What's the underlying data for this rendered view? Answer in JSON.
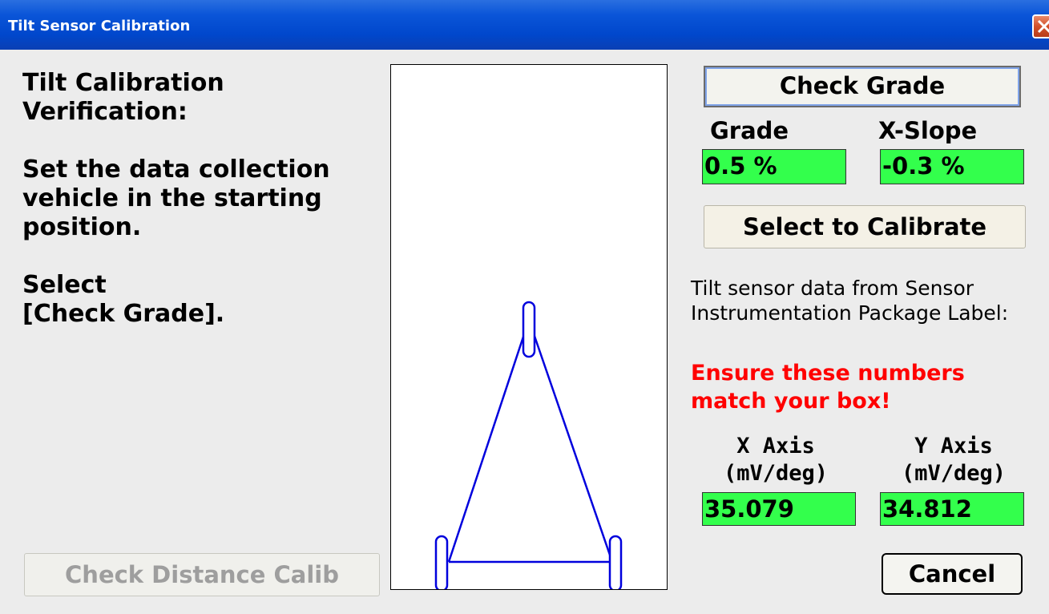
{
  "window": {
    "title": "Tilt Sensor Calibration"
  },
  "instructions": {
    "heading": "Tilt Calibration\nVerification:",
    "step1": "Set the data collection vehicle in the starting position.",
    "step2": "Select\n[Check Grade]."
  },
  "buttons": {
    "check_grade": "Check Grade",
    "select_to_calibrate": "Select to Calibrate",
    "cancel": "Cancel",
    "check_distance_calib": "Check Distance Calib"
  },
  "grade": {
    "label": "Grade",
    "value": "0.5 %"
  },
  "xslope": {
    "label": "X-Slope",
    "value": "-0.3 %"
  },
  "info": {
    "text": "Tilt sensor data from Sensor Instrumentation Package Label:",
    "warning": "Ensure these numbers match your box!"
  },
  "x_axis": {
    "label": "X Axis\n(mV/deg)",
    "value": "35.079"
  },
  "y_axis": {
    "label": "Y Axis\n(mV/deg)",
    "value": "34.812"
  },
  "colors": {
    "titlebar": "#0047cc",
    "value_box": "#33ff4c",
    "warning_text": "#ff0000",
    "diagram_line": "#0000dd"
  },
  "icons": {
    "close": "close-icon",
    "vehicle": "vehicle-diagram"
  }
}
